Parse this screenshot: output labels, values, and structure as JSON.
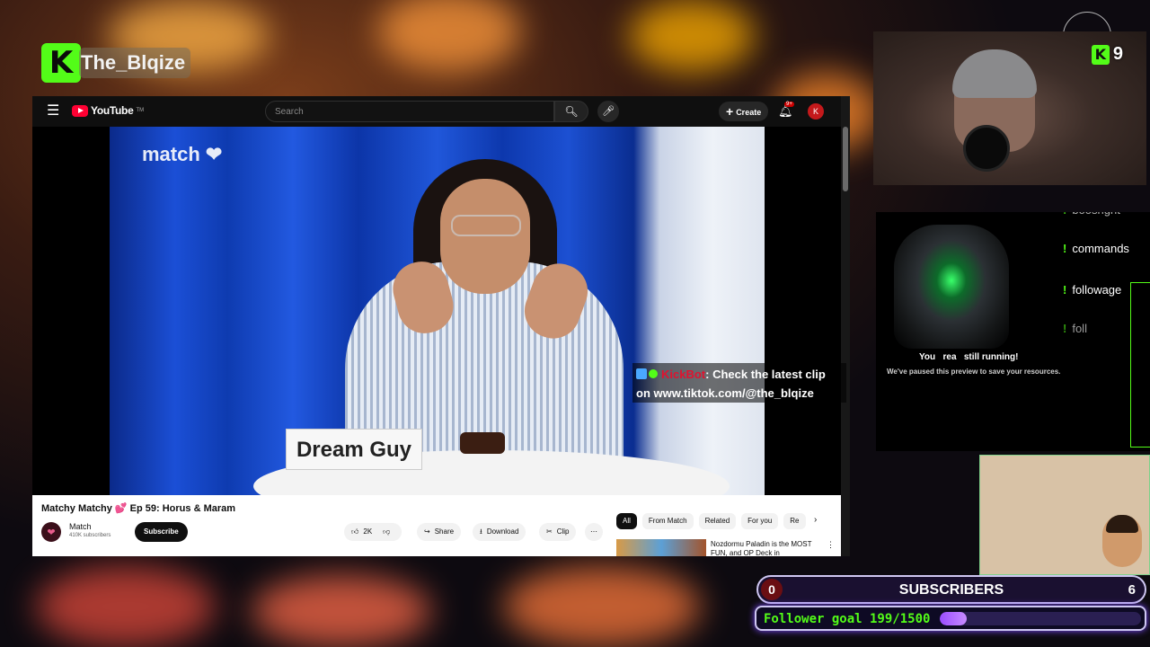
{
  "stream": {
    "username": "The_Blqize",
    "platform_icon": "kick-logo-icon",
    "viewer_count": "9",
    "accent": "#53fc18"
  },
  "youtube": {
    "logo_text": "YouTube",
    "logo_tm": "TM",
    "search_placeholder": "Search",
    "create_label": "Create",
    "notification_count": "9+",
    "avatar_letter": "K",
    "video": {
      "brand_watermark": "match",
      "nameplate": "Dream Guy",
      "title": "Matchy Matchy 💕 Ep 59: Horus & Maram",
      "channel_name": "Match",
      "channel_subs": "410K subscribers",
      "subscribe_label": "Subscribe",
      "likes": "2K",
      "share_label": "Share",
      "download_label": "Download",
      "clip_label": "Clip"
    },
    "chips": [
      "All",
      "From Match",
      "Related",
      "For you",
      "Re"
    ],
    "recommendation": {
      "title": "Nozdormu Paladin is the MOST FUN, and OP Deck in"
    }
  },
  "kickbot": {
    "name": "KickBot",
    "message": ": Check the latest clip on www.tiktok.com/@the_blqize"
  },
  "panel": {
    "paused_title_a": "You",
    "paused_title_b": "rea",
    "paused_title_c": "still running!",
    "paused_sub": "We've paused this preview to save your resources.",
    "commands": [
      "boosngnt",
      "commands",
      "followage",
      "foll"
    ]
  },
  "subscribers": {
    "label": "SUBSCRIBERS",
    "current": "0",
    "goal": "6"
  },
  "follower_goal": {
    "text": "Follower goal 199/1500",
    "current": 199,
    "target": 1500
  }
}
